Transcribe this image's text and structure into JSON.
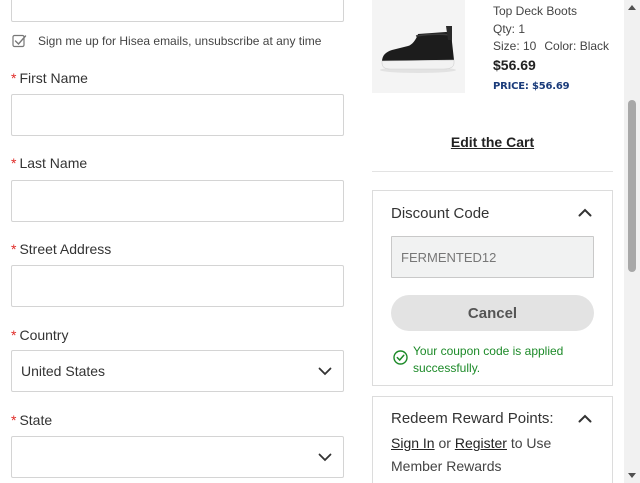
{
  "form": {
    "newsletter_label": "Sign me up for Hisea emails, unsubscribe at any time",
    "required_marker": "*",
    "first_name_label": "First Name",
    "last_name_label": "Last Name",
    "street_label": "Street Address",
    "country_label": "Country",
    "country_value": "United States",
    "state_label": "State",
    "state_value": ""
  },
  "cart_item": {
    "name": "Top Deck Boots",
    "qty": "Qty: 1",
    "size": "Size: 10",
    "color": "Color: Black",
    "price": "$56.69",
    "price_tag": "PRICE: $56.69"
  },
  "edit_cart_label": "Edit the Cart",
  "discount": {
    "title": "Discount Code",
    "code_value": "FERMENTED12",
    "cancel_label": "Cancel",
    "success_message": "Your coupon code is applied successfully."
  },
  "rewards": {
    "title": "Redeem Reward Points:",
    "sign_in": "Sign In",
    "or": "or",
    "register": "Register",
    "to_use": "to Use",
    "member_rewards": "Member Rewards"
  },
  "colors": {
    "required": "#e02b27",
    "success": "#1c8a28",
    "price_tag": "#1a3b7a"
  },
  "icons": {
    "checkbox": "checkbox-icon",
    "chevron": "chevron-down-icon",
    "collapse": "chevron-up-icon",
    "success": "check-circle-icon"
  }
}
